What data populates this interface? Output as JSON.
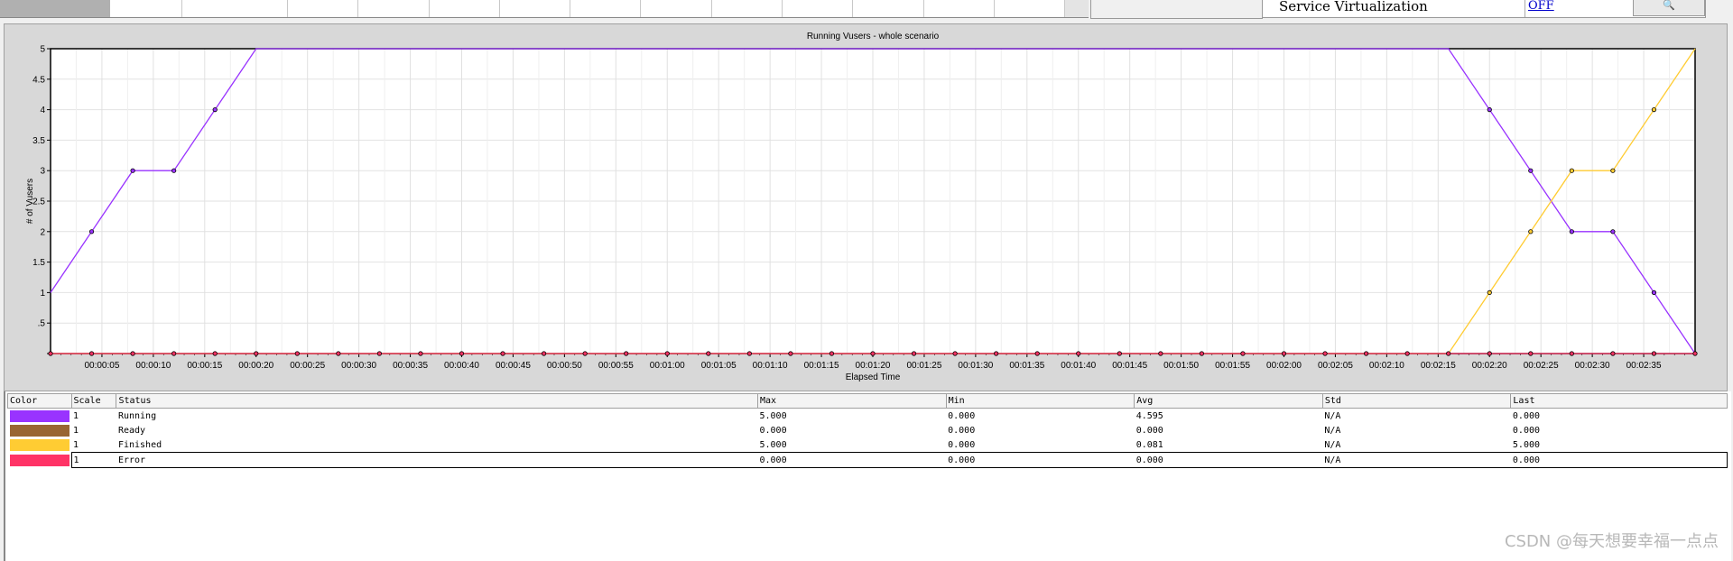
{
  "top_bar": {
    "service_virtualization_label": "Service Virtualization",
    "service_virtualization_status": "OFF",
    "search_button_glyph": "🔍"
  },
  "chart_data": {
    "type": "line",
    "title": "Running Vusers - whole scenario",
    "xlabel": "Elapsed Time",
    "ylabel": "# of Vusers",
    "ylim": [
      0,
      5
    ],
    "y_ticks": [
      "",
      ".5",
      "1",
      "1.5",
      "2",
      "2.5",
      "3",
      "3.5",
      "4",
      "4.5",
      "5"
    ],
    "x_unit": "seconds",
    "xlim": [
      0,
      160
    ],
    "x_tick_values": [
      5,
      10,
      15,
      20,
      25,
      30,
      35,
      40,
      45,
      50,
      55,
      60,
      65,
      70,
      75,
      80,
      85,
      90,
      95,
      100,
      105,
      110,
      115,
      120,
      125,
      130,
      135,
      140,
      145,
      150,
      155
    ],
    "x_tick_labels": [
      "00:00:05",
      "00:00:10",
      "00:00:15",
      "00:00:20",
      "00:00:25",
      "00:00:30",
      "00:00:35",
      "00:00:40",
      "00:00:45",
      "00:00:50",
      "00:00:55",
      "00:01:00",
      "00:01:05",
      "00:01:10",
      "00:01:15",
      "00:01:20",
      "00:01:25",
      "00:01:30",
      "00:01:35",
      "00:01:40",
      "00:01:45",
      "00:01:50",
      "00:01:55",
      "00:02:00",
      "00:02:05",
      "00:02:10",
      "00:02:15",
      "00:02:20",
      "00:02:25",
      "00:02:30",
      "00:02:35"
    ],
    "grid": true,
    "series": [
      {
        "name": "Running",
        "color": "#9933ff",
        "x": [
          0,
          4,
          8,
          12,
          16,
          20,
          136,
          140,
          144,
          148,
          152,
          156,
          160
        ],
        "y": [
          1,
          2,
          3,
          3,
          4,
          5,
          5,
          4,
          3,
          2,
          2,
          1,
          0
        ],
        "markers": [
          4,
          8,
          12,
          16,
          140,
          144,
          148,
          152,
          156
        ]
      },
      {
        "name": "Finished",
        "color": "#ffcc33",
        "x": [
          0,
          136,
          140,
          144,
          148,
          152,
          156,
          160
        ],
        "y": [
          0,
          0,
          1,
          2,
          3,
          3,
          4,
          5
        ],
        "markers": [
          140,
          144,
          148,
          152,
          156
        ]
      },
      {
        "name": "Error",
        "color": "#ff3366",
        "x": [
          0,
          160
        ],
        "y": [
          0,
          0
        ],
        "markers": [
          0,
          4,
          8,
          12,
          16,
          20,
          24,
          28,
          32,
          36,
          40,
          44,
          48,
          52,
          56,
          60,
          64,
          68,
          72,
          76,
          80,
          84,
          88,
          92,
          96,
          100,
          104,
          108,
          112,
          116,
          120,
          124,
          128,
          132,
          136,
          140,
          144,
          148,
          152,
          156,
          160
        ]
      }
    ]
  },
  "legend": {
    "headers": [
      "Color",
      "Scale",
      "Status",
      "Max",
      "Min",
      "Avg",
      "Std",
      "Last"
    ],
    "rows": [
      {
        "color": "#9933ff",
        "scale": "1",
        "status": "Running",
        "max": "5.000",
        "min": "0.000",
        "avg": "4.595",
        "std": "N/A",
        "last": "0.000"
      },
      {
        "color": "#996633",
        "scale": "1",
        "status": "Ready",
        "max": "0.000",
        "min": "0.000",
        "avg": "0.000",
        "std": "N/A",
        "last": "0.000"
      },
      {
        "color": "#ffcc33",
        "scale": "1",
        "status": "Finished",
        "max": "5.000",
        "min": "0.000",
        "avg": "0.081",
        "std": "N/A",
        "last": "5.000"
      },
      {
        "color": "#ff3366",
        "scale": "1",
        "status": "Error",
        "max": "0.000",
        "min": "0.000",
        "avg": "0.000",
        "std": "N/A",
        "last": "0.000"
      }
    ]
  },
  "watermark": "CSDN @每天想要幸福一点点"
}
